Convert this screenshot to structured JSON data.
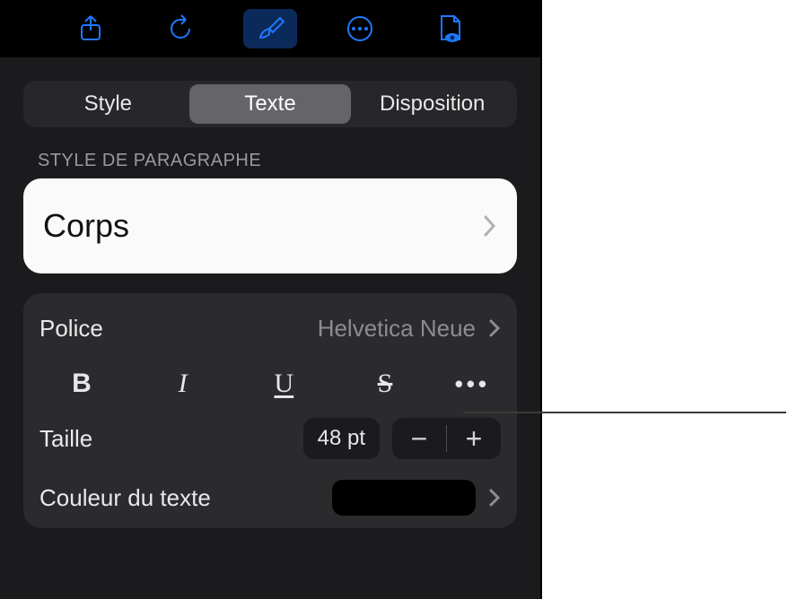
{
  "toolbar": {
    "share_icon": "share-icon",
    "undo_icon": "undo-icon",
    "format_icon": "paint-brush-icon",
    "more_icon": "more-icon",
    "doc_options_icon": "document-view-icon"
  },
  "tabs": {
    "style": "Style",
    "text": "Texte",
    "layout": "Disposition"
  },
  "paragraph": {
    "section_label": "STYLE DE PARAGRAPHE",
    "style_name": "Corps"
  },
  "font": {
    "label": "Police",
    "value": "Helvetica Neue",
    "style_buttons": {
      "bold": "B",
      "italic": "I",
      "underline": "U",
      "strike": "S",
      "more": "•••"
    }
  },
  "size": {
    "label": "Taille",
    "value": "48 pt",
    "minus": "−",
    "plus": "+"
  },
  "text_color": {
    "label": "Couleur du texte",
    "swatch_hex": "#000000"
  }
}
